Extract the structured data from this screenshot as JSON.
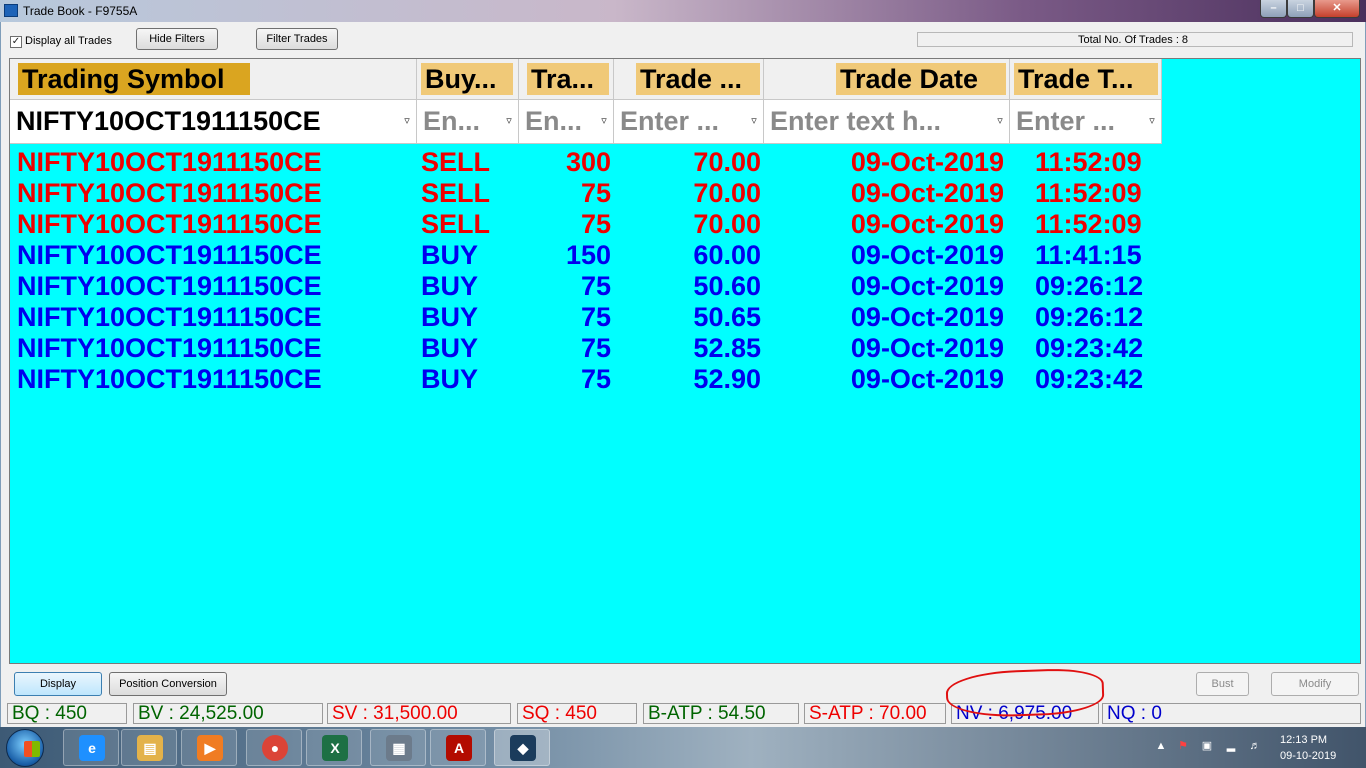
{
  "window": {
    "title": "Trade Book - F9755A",
    "minimize": "–",
    "maximize": "□",
    "close": "✕"
  },
  "toolbar": {
    "display_all_label": "Display all Trades",
    "display_all_checked": "✓",
    "hide_filters": "Hide Filters",
    "filter_trades": "Filter Trades",
    "total_trades": "Total No. Of Trades : 8"
  },
  "columns": [
    {
      "header": "Trading Symbol",
      "filter": "NIFTY10OCT1911150CE"
    },
    {
      "header": "Buy...",
      "filter": "En..."
    },
    {
      "header": "Tra...",
      "filter": "En..."
    },
    {
      "header": "Trade ...",
      "filter": "Enter ..."
    },
    {
      "header": "Trade Date",
      "filter": "Enter text h..."
    },
    {
      "header": "Trade T...",
      "filter": "Enter ..."
    }
  ],
  "filter_icon": "funnel-icon",
  "trades": [
    {
      "symbol": "NIFTY10OCT1911150CE",
      "side": "SELL",
      "qty": "300",
      "price": "70.00",
      "date": "09-Oct-2019",
      "time": "11:52:09"
    },
    {
      "symbol": "NIFTY10OCT1911150CE",
      "side": "SELL",
      "qty": "75",
      "price": "70.00",
      "date": "09-Oct-2019",
      "time": "11:52:09"
    },
    {
      "symbol": "NIFTY10OCT1911150CE",
      "side": "SELL",
      "qty": "75",
      "price": "70.00",
      "date": "09-Oct-2019",
      "time": "11:52:09"
    },
    {
      "symbol": "NIFTY10OCT1911150CE",
      "side": "BUY",
      "qty": "150",
      "price": "60.00",
      "date": "09-Oct-2019",
      "time": "11:41:15"
    },
    {
      "symbol": "NIFTY10OCT1911150CE",
      "side": "BUY",
      "qty": "75",
      "price": "50.60",
      "date": "09-Oct-2019",
      "time": "09:26:12"
    },
    {
      "symbol": "NIFTY10OCT1911150CE",
      "side": "BUY",
      "qty": "75",
      "price": "50.65",
      "date": "09-Oct-2019",
      "time": "09:26:12"
    },
    {
      "symbol": "NIFTY10OCT1911150CE",
      "side": "BUY",
      "qty": "75",
      "price": "52.85",
      "date": "09-Oct-2019",
      "time": "09:23:42"
    },
    {
      "symbol": "NIFTY10OCT1911150CE",
      "side": "BUY",
      "qty": "75",
      "price": "52.90",
      "date": "09-Oct-2019",
      "time": "09:23:42"
    }
  ],
  "buttons": {
    "display": "Display",
    "position_conversion": "Position Conversion",
    "bust": "Bust",
    "modify": "Modify"
  },
  "status": {
    "bq": "BQ : 450",
    "bv": "BV : 24,525.00",
    "sv": "SV : 31,500.00",
    "sq": "SQ : 450",
    "batp": "B-ATP : 54.50",
    "satp": "S-ATP : 70.00",
    "nv": "NV : 6,975.00",
    "nq": "NQ : 0"
  },
  "colors": {
    "grid_bg": "#00ffff",
    "sell": "#ee0000",
    "buy": "#0000ee",
    "buy_stat": "#006400",
    "sell_stat": "#ee0000",
    "net_stat": "#0000cc",
    "annotation": "#e01010"
  },
  "taskbar": {
    "apps": [
      "internet-explorer-icon",
      "file-explorer-icon",
      "media-player-icon",
      "chrome-icon",
      "excel-icon",
      "calculator-icon",
      "acrobat-icon",
      "trading-terminal-icon"
    ],
    "time": "12:13 PM",
    "date": "09-10-2019"
  }
}
